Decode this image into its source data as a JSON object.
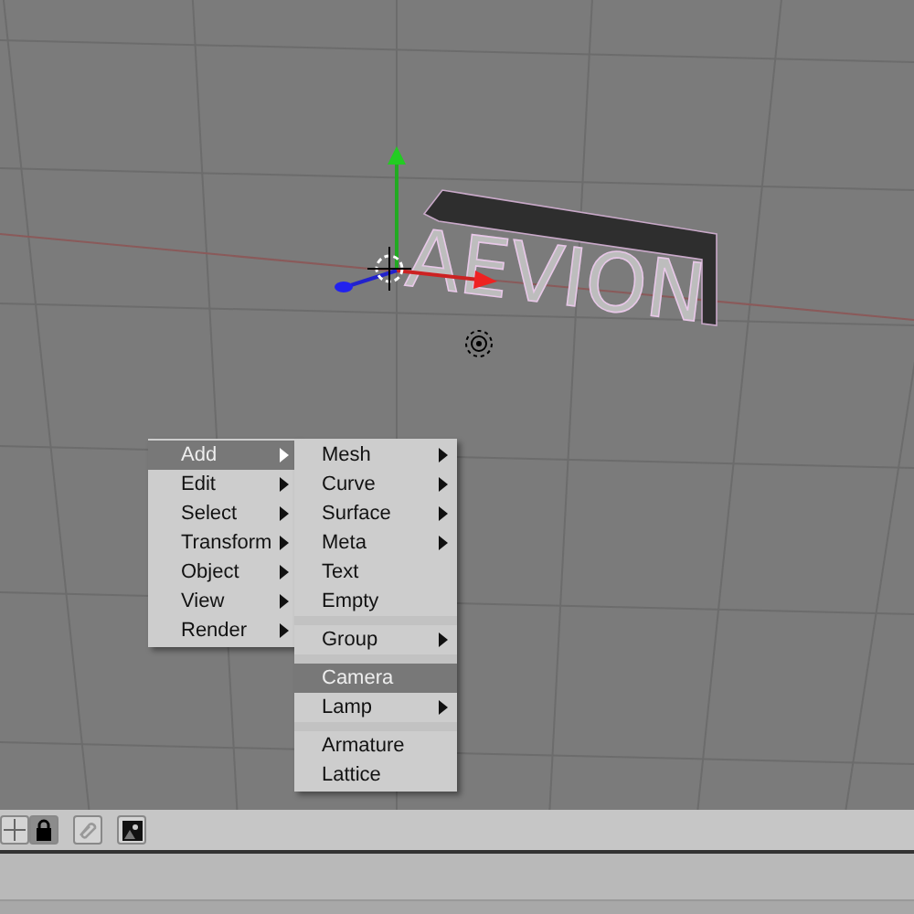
{
  "viewport": {
    "scene_text": "AEVION"
  },
  "menu": {
    "items": [
      {
        "label": "Add",
        "selected": true,
        "has_submenu": true
      },
      {
        "label": "Edit",
        "selected": false,
        "has_submenu": true
      },
      {
        "label": "Select",
        "selected": false,
        "has_submenu": true
      },
      {
        "label": "Transform",
        "selected": false,
        "has_submenu": true
      },
      {
        "label": "Object",
        "selected": false,
        "has_submenu": true
      },
      {
        "label": "View",
        "selected": false,
        "has_submenu": true
      },
      {
        "label": "Render",
        "selected": false,
        "has_submenu": true
      }
    ]
  },
  "submenu": {
    "sections": [
      [
        {
          "label": "Mesh",
          "selected": false,
          "has_submenu": true
        },
        {
          "label": "Curve",
          "selected": false,
          "has_submenu": true
        },
        {
          "label": "Surface",
          "selected": false,
          "has_submenu": true
        },
        {
          "label": "Meta",
          "selected": false,
          "has_submenu": true
        },
        {
          "label": "Text",
          "selected": false,
          "has_submenu": false
        },
        {
          "label": "Empty",
          "selected": false,
          "has_submenu": false
        }
      ],
      [
        {
          "label": "Group",
          "selected": false,
          "has_submenu": true
        }
      ],
      [
        {
          "label": "Camera",
          "selected": true,
          "has_submenu": false
        },
        {
          "label": "Lamp",
          "selected": false,
          "has_submenu": true
        }
      ],
      [
        {
          "label": "Armature",
          "selected": false,
          "has_submenu": false
        },
        {
          "label": "Lattice",
          "selected": false,
          "has_submenu": false
        }
      ]
    ]
  },
  "header": {
    "lock_on": true
  }
}
